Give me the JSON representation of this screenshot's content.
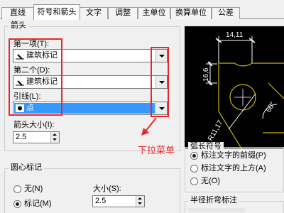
{
  "tabs": [
    {
      "label": "直线",
      "active": false
    },
    {
      "label": "符号和箭头",
      "active": true
    },
    {
      "label": "文字",
      "active": false
    },
    {
      "label": "调整",
      "active": false
    },
    {
      "label": "主单位",
      "active": false
    },
    {
      "label": "换算单位",
      "active": false
    },
    {
      "label": "公差",
      "active": false
    }
  ],
  "arrowheads": {
    "group_title": "箭头",
    "first_label": "第一项(T):",
    "first_value": "建筑标记",
    "second_label": "第二个(D):",
    "second_value": "建筑标记",
    "leader_label": "引线(L):",
    "leader_value": "点",
    "size_label": "箭头大小(I):",
    "size_value": "2.5"
  },
  "annotation": {
    "text": "下拉菜单",
    "color": "#e8292b"
  },
  "center_marks": {
    "group_title": "圆心标记",
    "option_none": "无(N)",
    "option_mark": "标记(M)",
    "selected": "mark",
    "size_label": "大小(S):",
    "size_value": "2.5"
  },
  "arc_length": {
    "group_title": "弧长符号",
    "option_prefix": "标注文字的前缀(P)",
    "option_above": "标注文字的上方(A)",
    "option_none": "无(O)",
    "selected": "prefix"
  },
  "radius_jog": {
    "group_title": "半径折弯标注"
  },
  "preview": {
    "dim_top": "14,11",
    "dim_left": "16,6",
    "dim_diag": "R11,17",
    "dim_angle": "60°",
    "line_color": "#ffffff",
    "accent_color": "#c8b400"
  }
}
